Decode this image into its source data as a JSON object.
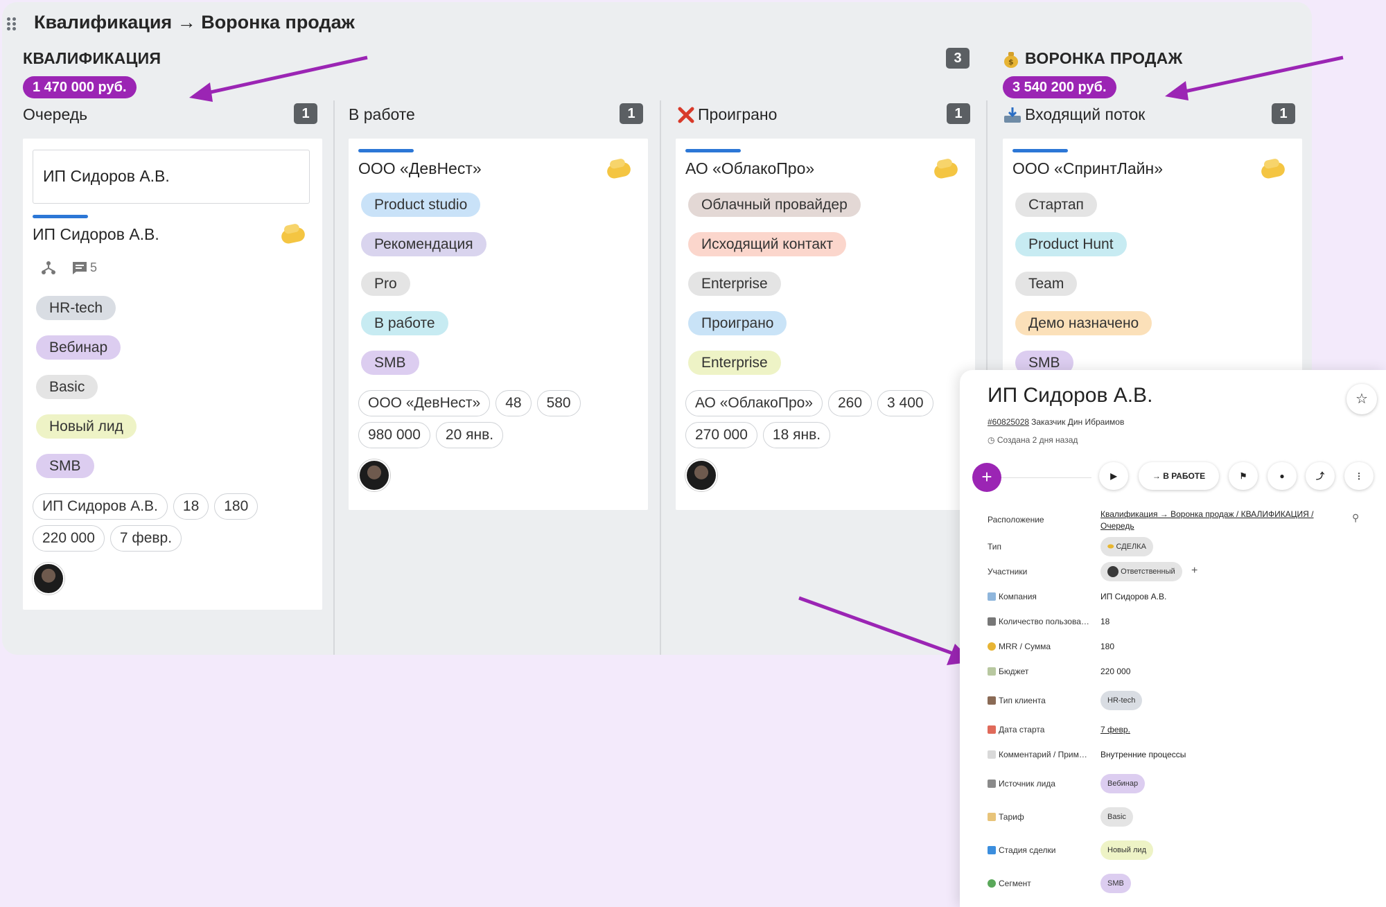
{
  "board": {
    "title": "Квалификация → Воронка продаж"
  },
  "groups": [
    {
      "title": "КВАЛИФИКАЦИЯ",
      "sum": "1 470 000 руб.",
      "count": "3"
    },
    {
      "title": "ВОРОНКА ПРОДАЖ",
      "sum": "3 540 200 руб.",
      "icon": "money-bag-icon"
    }
  ],
  "columns": [
    {
      "title": "Очередь",
      "count": "1"
    },
    {
      "title": "В работе",
      "count": "1"
    },
    {
      "title": "Проиграно",
      "count": "1",
      "icon": "red-x-icon"
    },
    {
      "title": "Входящий поток",
      "count": "1",
      "icon": "inbox-tray-icon"
    }
  ],
  "card_queue": {
    "input_value": "ИП Сидоров А.В.",
    "title": "ИП Сидоров А.В.",
    "comments": "5",
    "tags": [
      {
        "label": "HR-tech",
        "color": "#d9dde3"
      },
      {
        "label": "Вебинар",
        "color": "#dccdf0"
      },
      {
        "label": "Basic",
        "color": "#e4e4e4"
      },
      {
        "label": "Новый лид",
        "color": "#eef3c6"
      },
      {
        "label": "SMB",
        "color": "#dccdf0"
      }
    ],
    "chips": [
      "ИП Сидоров А.В.",
      "18",
      "180",
      "220 000",
      "7 февр."
    ]
  },
  "card_work": {
    "title": "ООО «ДевНест»",
    "tags": [
      {
        "label": "Product studio",
        "color": "#c9e2f8"
      },
      {
        "label": "Рекомендация",
        "color": "#d9d4ee"
      },
      {
        "label": "Pro",
        "color": "#e4e4e4"
      },
      {
        "label": "В работе",
        "color": "#c7ebf2"
      },
      {
        "label": "SMB",
        "color": "#dccdf0"
      }
    ],
    "chips": [
      "ООО «ДевНест»",
      "48",
      "580",
      "980 000",
      "20 янв."
    ]
  },
  "card_lost": {
    "title": "АО «ОблакоПро»",
    "tags": [
      {
        "label": "Облачный провайдер",
        "color": "#e3d8d5"
      },
      {
        "label": "Исходящий контакт",
        "color": "#fbd6cc"
      },
      {
        "label": "Enterprise",
        "color": "#e4e4e4"
      },
      {
        "label": "Проиграно",
        "color": "#c9e3f7"
      },
      {
        "label": "Enterprise",
        "color": "#eef3c6"
      }
    ],
    "chips": [
      "АО «ОблакоПро»",
      "260",
      "3 400",
      "270 000",
      "18 янв."
    ]
  },
  "card_inflow": {
    "title": "ООО «СпринтЛайн»",
    "tags": [
      {
        "label": "Стартап",
        "color": "#e4e4e4"
      },
      {
        "label": "Product Hunt",
        "color": "#c7ebf2"
      },
      {
        "label": "Team",
        "color": "#e4e4e4"
      },
      {
        "label": "Демо назначено",
        "color": "#fbe0b9"
      },
      {
        "label": "SMB",
        "color": "#dccdf0"
      }
    ]
  },
  "panel": {
    "title": "ИП Сидоров А.В.",
    "id": "#60825028",
    "customer": "Заказчик Дин Ибраимов",
    "created": "Создана 2 дня назад",
    "status_button": "В РАБОТЕ",
    "fields": [
      {
        "label": "Расположение",
        "value": "Квалификация → Воронка продаж / КВАЛИФИКАЦИЯ / Очередь"
      },
      {
        "label": "Тип",
        "value": "СДЕЛКА"
      },
      {
        "label": "Участники",
        "value": "Ответственный"
      },
      {
        "label": "Компания",
        "value": "ИП Сидоров А.В."
      },
      {
        "label": "Количество пользова…",
        "value": "18"
      },
      {
        "label": "MRR / Сумма",
        "value": "180"
      },
      {
        "label": "Бюджет",
        "value": "220 000"
      },
      {
        "label": "Тип клиента",
        "value": "HR-tech"
      },
      {
        "label": "Дата старта",
        "value": "7 февр."
      },
      {
        "label": "Комментарий / Прим…",
        "value": "Внутренние процессы"
      },
      {
        "label": "Источник лида",
        "value": "Вебинар"
      },
      {
        "label": "Тариф",
        "value": "Basic"
      },
      {
        "label": "Стадия сделки",
        "value": "Новый лид"
      },
      {
        "label": "Сегмент",
        "value": "SMB"
      }
    ]
  },
  "colors": {
    "accent": "#9b25b4",
    "bar": "#2c77d6",
    "count_badge": "#5b5f63"
  }
}
